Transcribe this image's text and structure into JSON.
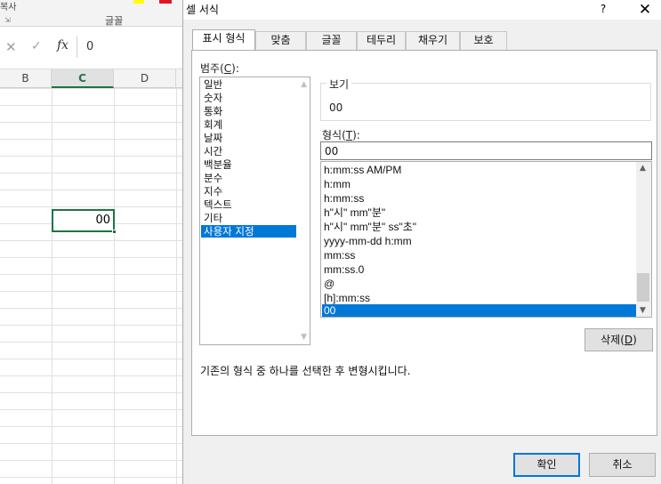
{
  "excel": {
    "ribbon": {
      "clipboard_label_fragment": "복사",
      "group_launcher_icon": "dialog-launcher-icon",
      "font_group_label": "글꼴",
      "accent_yellow": "#ffff00",
      "accent_red": "#e81123"
    },
    "formula_bar": {
      "cancel_icon": "cancel-x-icon",
      "enter_icon": "enter-check-icon",
      "function_icon": "fx-icon",
      "fx_symbol": "fx",
      "value": "0"
    },
    "column_headers": [
      "B",
      "C",
      "D"
    ],
    "selected_column": "C",
    "active_cell_value": "00",
    "grid_accent": "#217346"
  },
  "dialog": {
    "title": "셀 서식",
    "help_label": "?",
    "close_label": "✕",
    "tabs": [
      {
        "label": "표시 형식",
        "active": true
      },
      {
        "label": "맞춤",
        "active": false
      },
      {
        "label": "글꼴",
        "active": false
      },
      {
        "label": "테두리",
        "active": false
      },
      {
        "label": "채우기",
        "active": false
      },
      {
        "label": "보호",
        "active": false
      }
    ],
    "category": {
      "label_prefix": "범주(",
      "label_hotkey": "C",
      "label_suffix": "):",
      "items": [
        "일반",
        "숫자",
        "통화",
        "회계",
        "날짜",
        "시간",
        "백분율",
        "분수",
        "지수",
        "텍스트",
        "기타",
        "사용자 지정"
      ],
      "selected": "사용자 지정"
    },
    "sample": {
      "label": "보기",
      "value": "00"
    },
    "type_field": {
      "label_prefix": "형식(",
      "label_hotkey": "T",
      "label_suffix": "):",
      "value": "00"
    },
    "format_list": {
      "items": [
        "h:mm:ss AM/PM",
        "h:mm",
        "h:mm:ss",
        "h\"시\" mm\"분\"",
        "h\"시\" mm\"분\" ss\"초\"",
        "yyyy-mm-dd h:mm",
        "mm:ss",
        "mm:ss.0",
        "@",
        "[h]:mm:ss",
        "00"
      ],
      "selected": "00"
    },
    "delete_button": {
      "label_prefix": "삭제(",
      "label_hotkey": "D",
      "label_suffix": ")"
    },
    "description": "기존의 형식 중 하나를 선택한 후 변형시킵니다.",
    "ok_label": "확인",
    "cancel_label": "취소",
    "selection_color": "#0078d7"
  }
}
